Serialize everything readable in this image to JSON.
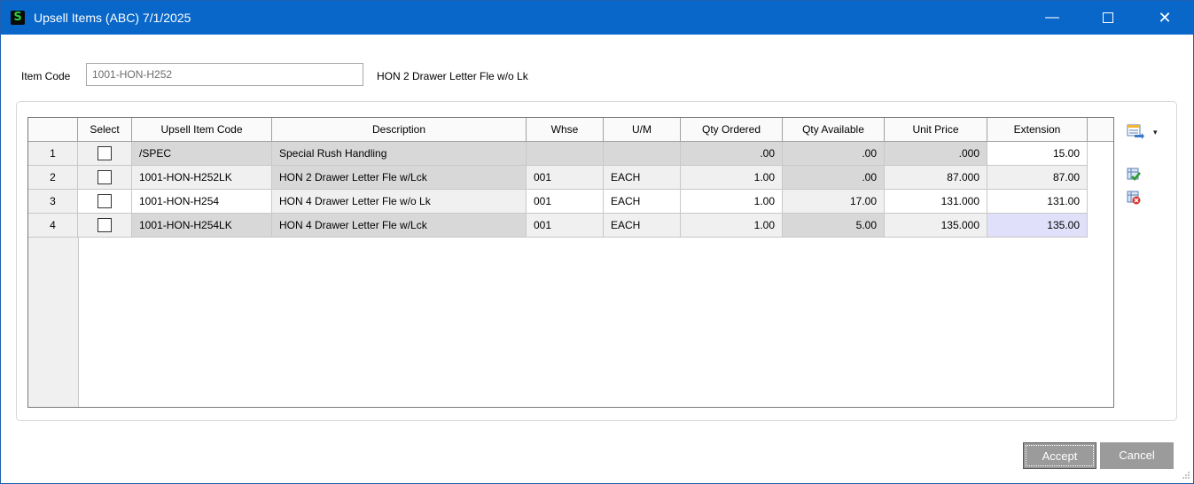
{
  "window": {
    "icon_letter": "S",
    "title": "Upsell Items (ABC) 7/1/2025",
    "min_glyph": "—",
    "close_glyph": "✕",
    "titlebar_color": "#0867c9"
  },
  "item": {
    "label": "Item Code",
    "value": "1001-HON-H252",
    "description": "HON 2 Drawer Letter Fle w/o Lk"
  },
  "grid": {
    "columns": [
      "Select",
      "Upsell Item Code",
      "Description",
      "Whse",
      "U/M",
      "Qty Ordered",
      "Qty Available",
      "Unit Price",
      "Extension"
    ],
    "rows": [
      {
        "num": "1",
        "code": "/SPEC",
        "desc": "Special Rush Handling",
        "whse": "",
        "um": "",
        "qty_ordered": ".00",
        "qty_available": ".00",
        "unit_price": ".000",
        "extension": "15.00",
        "selected": false
      },
      {
        "num": "2",
        "code": "1001-HON-H252LK",
        "desc": "HON 2 Drawer Letter Fle w/Lck",
        "whse": "001",
        "um": "EACH",
        "qty_ordered": "1.00",
        "qty_available": ".00",
        "unit_price": "87.000",
        "extension": "87.00",
        "selected": false
      },
      {
        "num": "3",
        "code": "1001-HON-H254",
        "desc": "HON 4 Drawer Letter Fle w/o Lk",
        "whse": "001",
        "um": "EACH",
        "qty_ordered": "1.00",
        "qty_available": "17.00",
        "unit_price": "131.000",
        "extension": "131.00",
        "selected": false
      },
      {
        "num": "4",
        "code": "1001-HON-H254LK",
        "desc": "HON 4 Drawer Letter Fle w/Lck",
        "whse": "001",
        "um": "EACH",
        "qty_ordered": "1.00",
        "qty_available": "5.00",
        "unit_price": "135.000",
        "extension": "135.00",
        "selected": false
      }
    ]
  },
  "side_icons": {
    "settings": "grid-settings-icon",
    "caret": "▾",
    "select_all": "select-all-icon",
    "clear_all": "clear-all-icon"
  },
  "buttons": {
    "accept": "Accept",
    "cancel": "Cancel"
  },
  "colors": {
    "accent": "#0867c9",
    "button_bg": "#9b9b9b",
    "selected_cell": "#e0e0fa"
  }
}
